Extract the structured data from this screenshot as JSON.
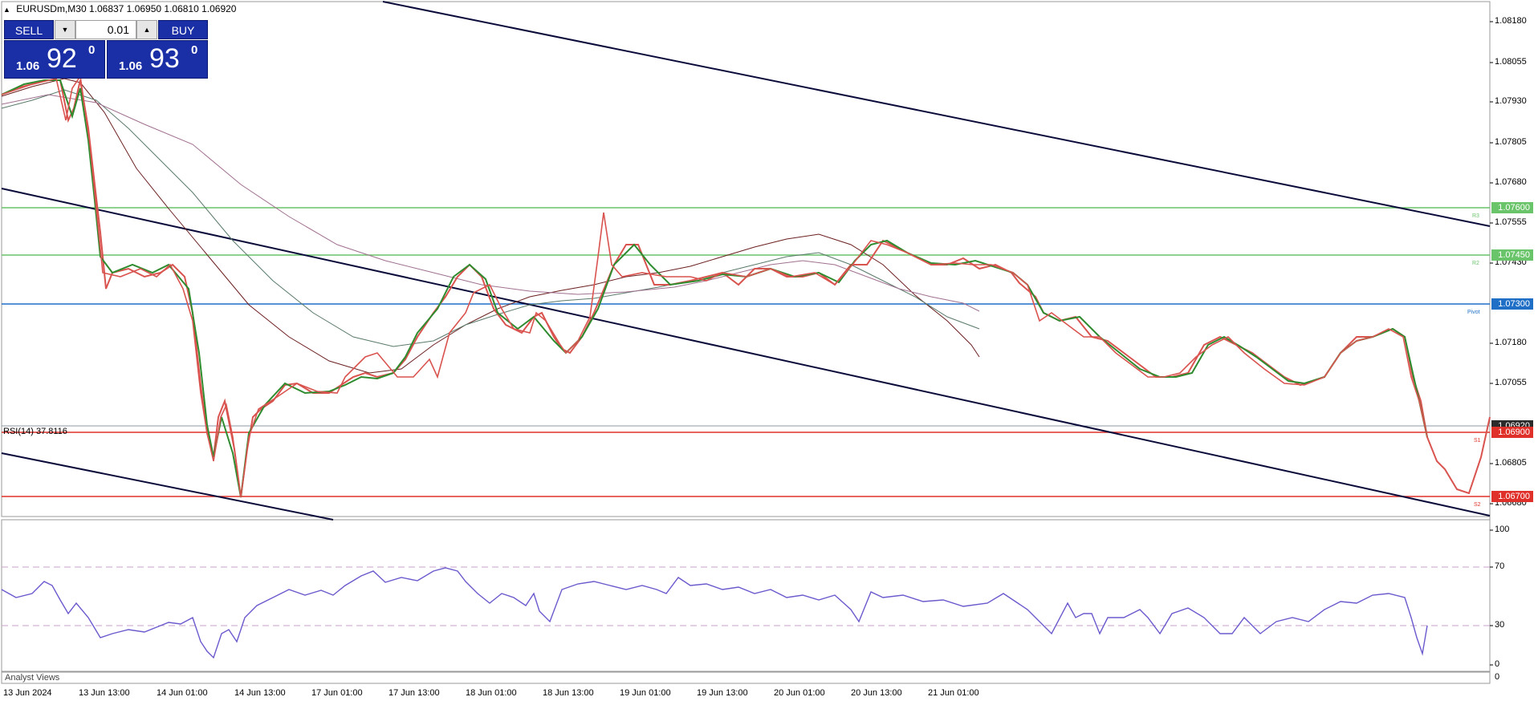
{
  "header": {
    "symbol": "EURUSDm,M30",
    "ohlc": "1.06837 1.06950 1.06810 1.06920"
  },
  "trade_panel": {
    "sell_label": "SELL",
    "buy_label": "BUY",
    "lot": "0.01",
    "sell_prefix": "1.06",
    "sell_big": "92",
    "sell_sup": "0",
    "buy_prefix": "1.06",
    "buy_big": "93",
    "buy_sup": "0"
  },
  "price_axis": [
    "1.08180",
    "1.08055",
    "1.07930",
    "1.07805",
    "1.07680",
    "1.07555",
    "1.07430",
    "1.07180",
    "1.07055",
    "1.06805",
    "1.06680"
  ],
  "levels": {
    "r3": {
      "price": "1.07600",
      "tag": "R3",
      "color": "#6ac46a"
    },
    "r2": {
      "price": "1.07450",
      "tag": "R2",
      "color": "#6ac46a"
    },
    "pivot": {
      "price": "1.07300",
      "tag": "Pivot",
      "color": "#1f6fc7"
    },
    "s1": {
      "price": "1.06900",
      "tag": "S1",
      "color": "#e0302a"
    },
    "s2": {
      "price": "1.06700",
      "tag": "S2",
      "color": "#e0302a"
    },
    "current": {
      "price": "1.06920",
      "color": "#2b2b2b"
    }
  },
  "rsi": {
    "title": "RSI(14) 37.8116",
    "levels": [
      "100",
      "70",
      "30",
      "0"
    ]
  },
  "analyst_label": "Analyst Views",
  "time_axis": [
    "13 Jun 2024",
    "13 Jun 13:00",
    "14 Jun 01:00",
    "14 Jun 13:00",
    "17 Jun 01:00",
    "17 Jun 13:00",
    "18 Jun 01:00",
    "18 Jun 13:00",
    "19 Jun 01:00",
    "19 Jun 13:00",
    "20 Jun 01:00",
    "20 Jun 13:00",
    "21 Jun 01:00"
  ],
  "colors": {
    "trade_blue": "#1a2fa6",
    "bull_candle": "#2e8b2e",
    "bear_candle": "#d9534f",
    "rsi_line": "#6a5acd"
  }
}
